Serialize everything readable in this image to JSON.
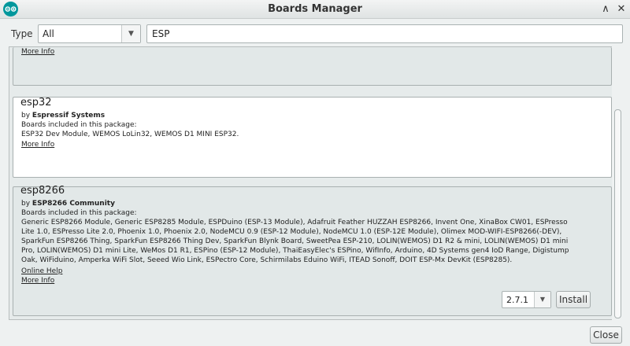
{
  "window": {
    "title": "Boards Manager",
    "minimize_glyph": "∧",
    "close_glyph": "✕"
  },
  "filter": {
    "type_label": "Type",
    "type_value": "All",
    "search_value": "ESP"
  },
  "entries": {
    "previous": {
      "more_info": "More Info"
    },
    "esp32": {
      "name": "esp32",
      "by_prefix": "by",
      "author": "Espressif Systems",
      "boards_label": "Boards included in this package:",
      "boards": "ESP32 Dev Module, WEMOS LoLin32, WEMOS D1 MINI ESP32.",
      "more_info": "More Info"
    },
    "esp8266": {
      "name": "esp8266",
      "by_prefix": "by",
      "author": "ESP8266 Community",
      "boards_label": "Boards included in this package:",
      "boards": "Generic ESP8266 Module, Generic ESP8285 Module, ESPDuino (ESP-13 Module), Adafruit Feather HUZZAH ESP8266, Invent One, XinaBox CW01, ESPresso Lite 1.0, ESPresso Lite 2.0, Phoenix 1.0, Phoenix 2.0, NodeMCU 0.9 (ESP-12 Module), NodeMCU 1.0 (ESP-12E Module), Olimex MOD-WIFI-ESP8266(-DEV), SparkFun ESP8266 Thing, SparkFun ESP8266 Thing Dev, SparkFun Blynk Board, SweetPea ESP-210, LOLIN(WEMOS) D1 R2 & mini, LOLIN(WEMOS) D1 mini Pro, LOLIN(WEMOS) D1 mini Lite, WeMos D1 R1, ESPino (ESP-12 Module), ThaiEasyElec's ESPino, WifInfo, Arduino, 4D Systems gen4 IoD Range, Digistump Oak, WiFiduino, Amperka WiFi Slot, Seeed Wio Link, ESPectro Core, Schirmilabs Eduino WiFi, ITEAD Sonoff, DOIT ESP-Mx DevKit (ESP8285).",
      "online_help": "Online Help",
      "more_info": "More Info",
      "version": "2.7.1",
      "install_label": "Install"
    }
  },
  "footer": {
    "close_label": "Close"
  },
  "colors": {
    "accent": "#00979c",
    "link": "#1b3cc8",
    "selected_row": "#e2e8e8"
  }
}
